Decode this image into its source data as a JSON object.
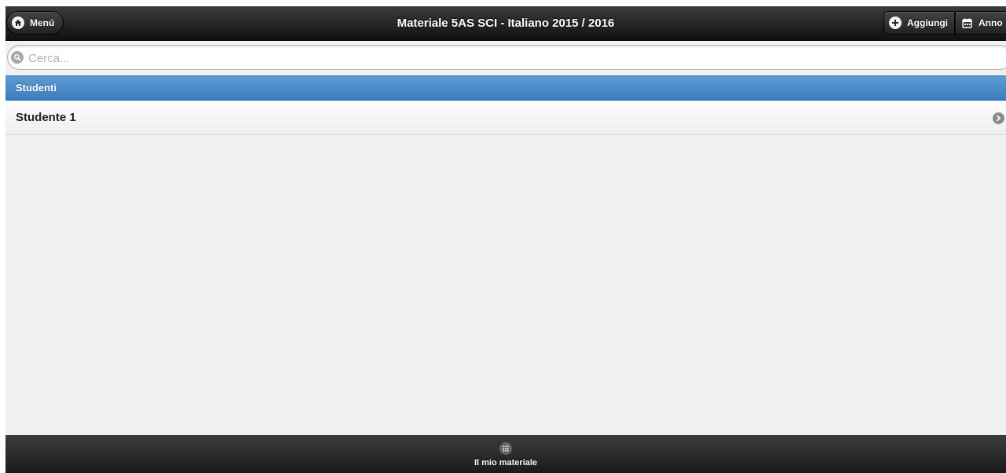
{
  "header": {
    "title": "Materiale 5AS SCI - Italiano 2015 / 2016",
    "menu_label": "Menú",
    "menu_icon": "home-icon",
    "add_label": "Aggiungi",
    "add_icon": "plus-icon",
    "year_label": "Anno",
    "year_icon": "calendar-icon"
  },
  "search": {
    "placeholder": "Cerca...",
    "value": "",
    "icon": "search-icon"
  },
  "list": {
    "divider": "Studenti",
    "items": [
      {
        "label": "Studente 1",
        "icon": "chevron-right-icon"
      }
    ]
  },
  "footer": {
    "nav_label": "Il mio materiale",
    "nav_icon": "grid-icon"
  },
  "colors": {
    "header_bg": "#1f1f1f",
    "divider_bg": "#4a8bc9",
    "content_bg": "#f1f1f1"
  }
}
